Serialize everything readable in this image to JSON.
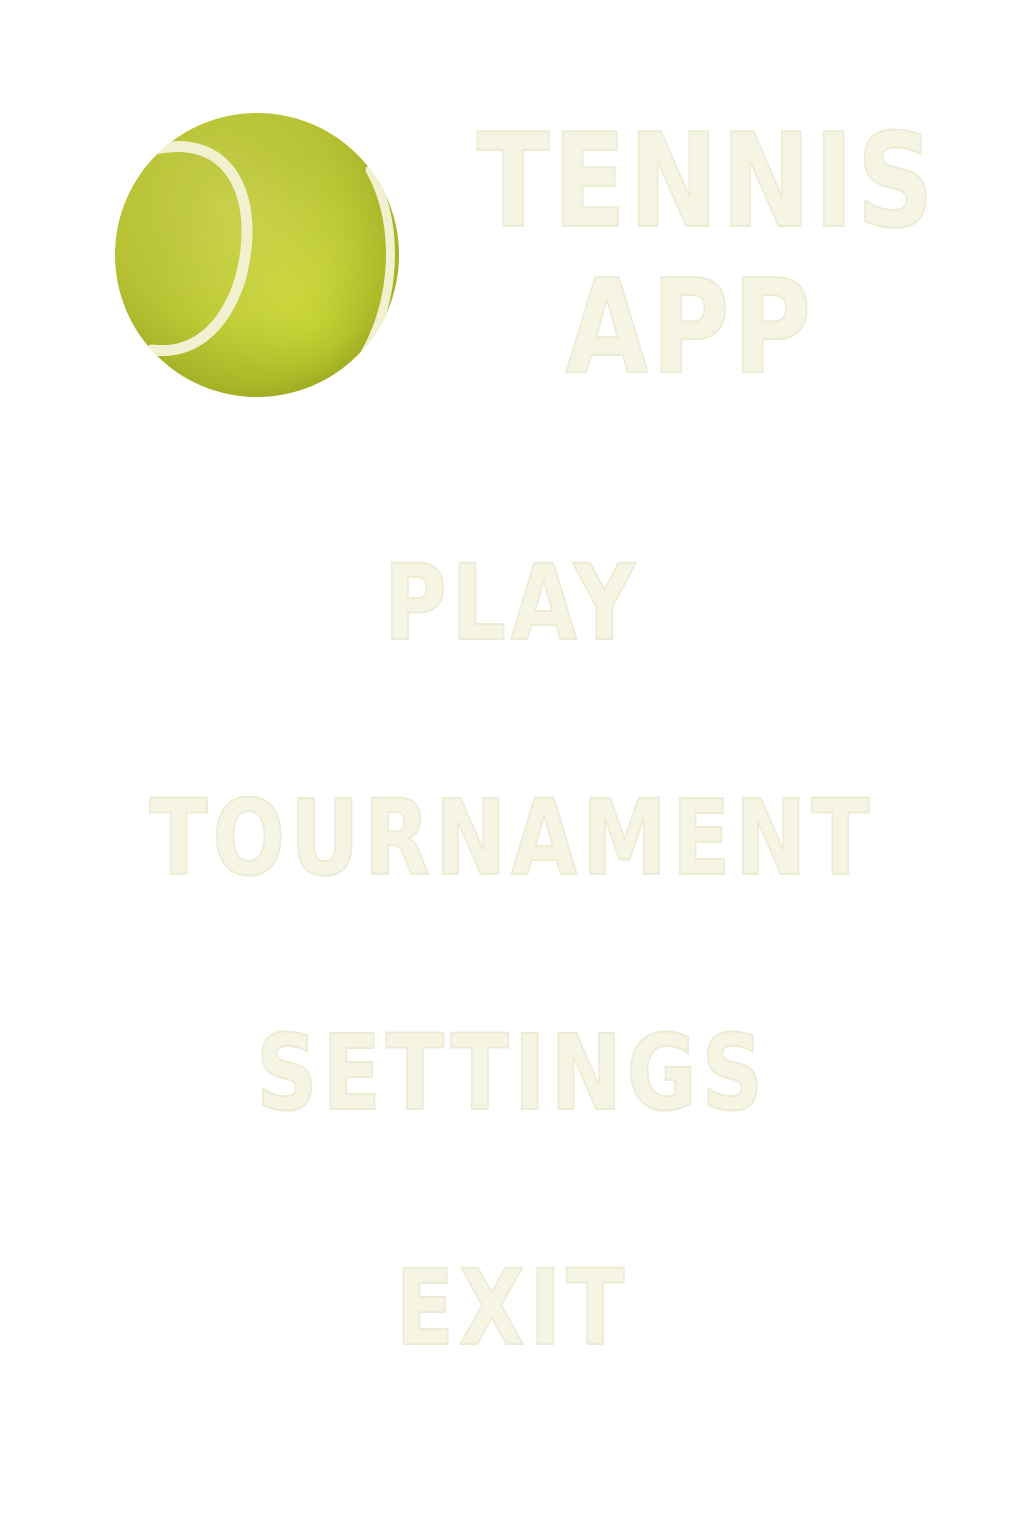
{
  "app": {
    "title_line1": "TENNIS",
    "title_line2": "APP",
    "logo_icon": "tennis-ball-icon"
  },
  "menu": {
    "items": [
      {
        "id": "play",
        "label": "PLAY"
      },
      {
        "id": "tournament",
        "label": "TOURNAMENT"
      },
      {
        "id": "settings",
        "label": "SETTINGS"
      },
      {
        "id": "exit",
        "label": "EXIT"
      }
    ]
  },
  "colors": {
    "background": "#ffffff",
    "text_cream": "#f6f5e4",
    "ball_yellow": "#dbe54a",
    "ball_seam": "#f1f0cf"
  }
}
